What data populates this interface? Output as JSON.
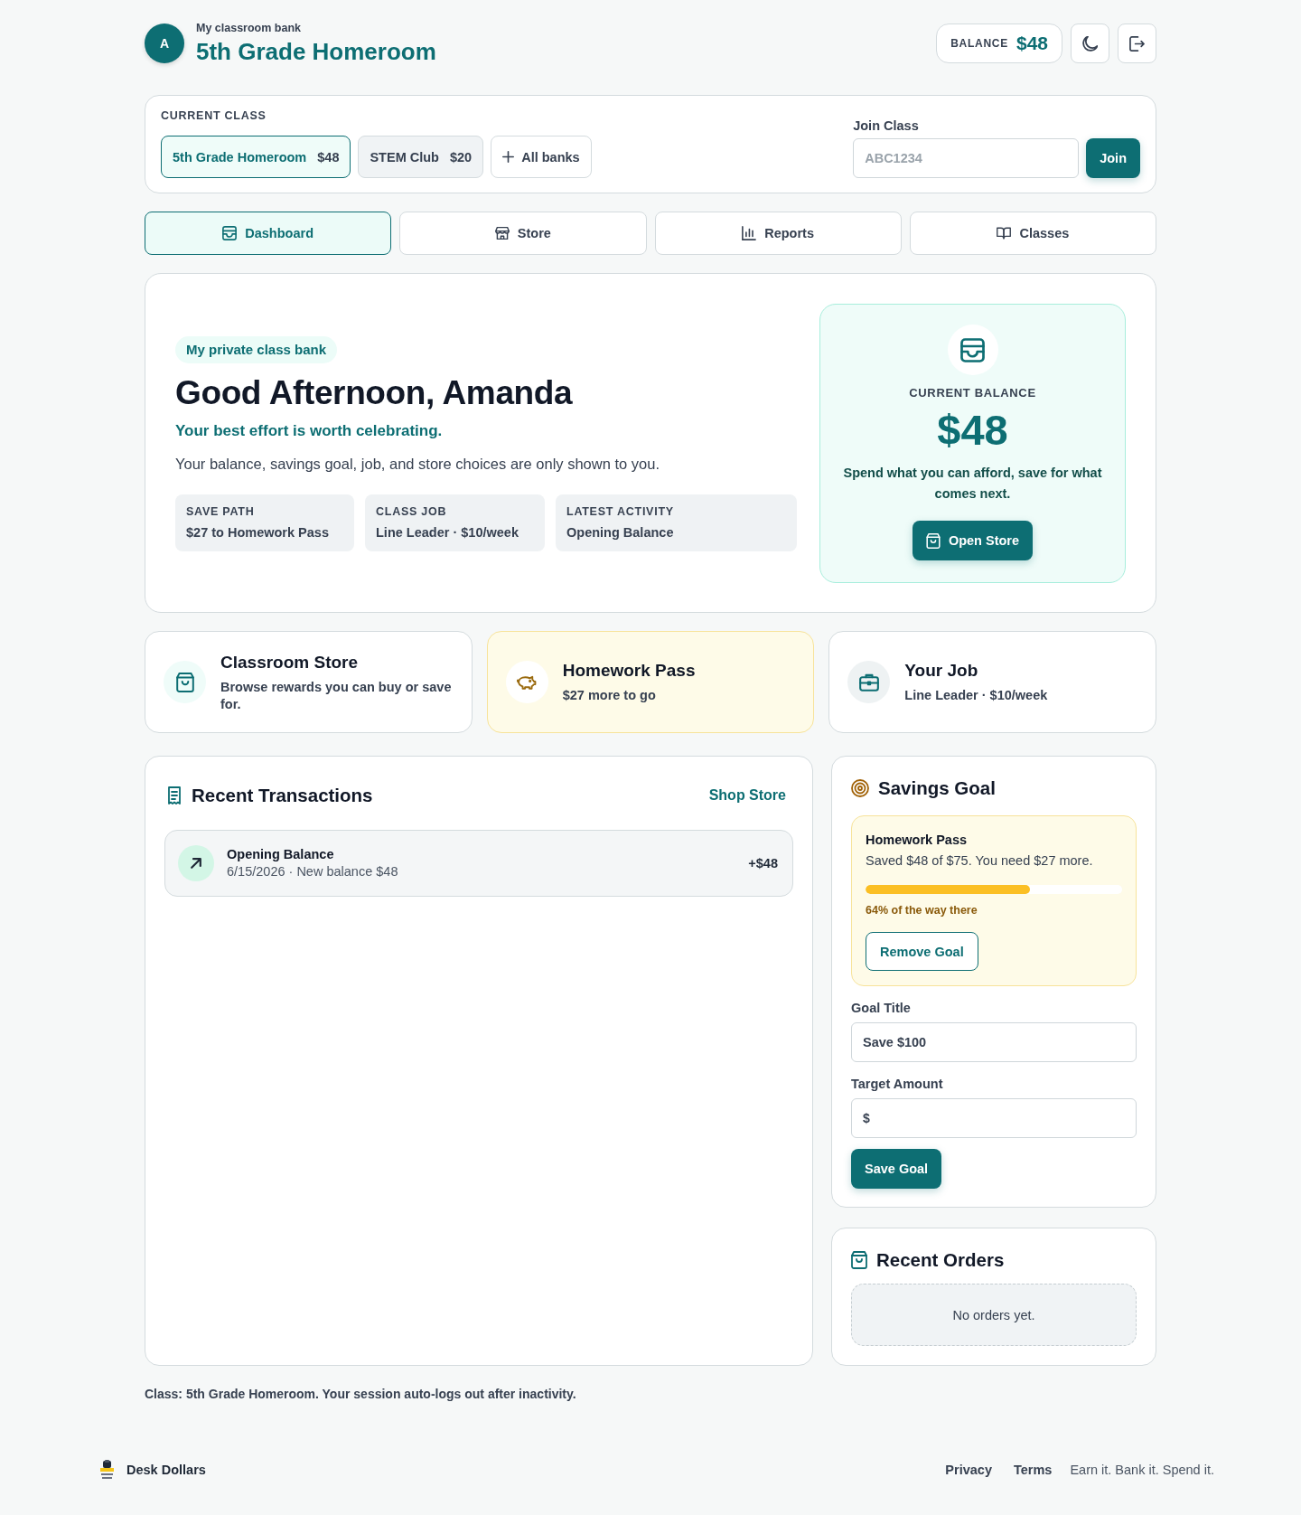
{
  "header": {
    "avatar": "A",
    "subtitle": "My classroom bank",
    "title": "5th Grade Homeroom",
    "balance_label": "BALANCE",
    "balance": "$48"
  },
  "class_picker": {
    "label": "CURRENT CLASS",
    "classes": [
      {
        "name": "5th Grade Homeroom",
        "balance": "$48",
        "selected": true
      },
      {
        "name": "STEM Club",
        "balance": "$20",
        "selected": false
      }
    ],
    "all_banks": "All banks",
    "join": {
      "label": "Join Class",
      "placeholder": "ABC1234",
      "button": "Join"
    }
  },
  "tabs": [
    {
      "label": "Dashboard",
      "selected": true
    },
    {
      "label": "Store",
      "selected": false
    },
    {
      "label": "Reports",
      "selected": false
    },
    {
      "label": "Classes",
      "selected": false
    }
  ],
  "hero": {
    "badge": "My private class bank",
    "greeting": "Good Afternoon, Amanda",
    "tagline": "Your best effort is worth celebrating.",
    "note": "Your balance, savings goal, job, and store choices are only shown to you.",
    "stats": [
      {
        "label": "SAVE PATH",
        "value": "$27 to Homework Pass"
      },
      {
        "label": "CLASS JOB",
        "value": "Line Leader · $10/week"
      },
      {
        "label": "LATEST ACTIVITY",
        "value": "Opening Balance"
      }
    ],
    "balance_panel": {
      "label": "CURRENT BALANCE",
      "amount": "$48",
      "note": "Spend what you can afford, save for what comes next.",
      "button": "Open Store"
    }
  },
  "summary_cards": [
    {
      "kind": "store",
      "title": "Classroom Store",
      "text": "Browse rewards you can buy or save for."
    },
    {
      "kind": "goal",
      "title": "Homework Pass",
      "text": "$27 more to go"
    },
    {
      "kind": "job",
      "title": "Your Job",
      "text": "Line Leader · $10/week"
    }
  ],
  "transactions": {
    "title": "Recent Transactions",
    "link": "Shop Store",
    "items": [
      {
        "title": "Opening Balance",
        "meta": "6/15/2026 · New balance $48",
        "amount": "+$48"
      }
    ]
  },
  "savings_goal": {
    "title": "Savings Goal",
    "goal": {
      "name": "Homework Pass",
      "summary": "Saved $48 of $75. You need $27 more.",
      "level": 0.64,
      "progress_text": "64% of the way there",
      "button": "Remove Goal"
    },
    "fields": [
      {
        "label": "Goal Title",
        "value": "Save $100"
      },
      {
        "label": "Target Amount",
        "prefix": "$"
      }
    ],
    "button": "Save Goal"
  },
  "recent_orders": {
    "title": "Recent Orders",
    "empty": "No orders yet."
  },
  "footer_note": "Class: 5th Grade Homeroom. Your session auto-logs out after inactivity.",
  "footer": {
    "brand": "Desk Dollars",
    "links": [
      "Privacy",
      "Terms"
    ],
    "tagline": "Earn it. Bank it. Spend it."
  }
}
